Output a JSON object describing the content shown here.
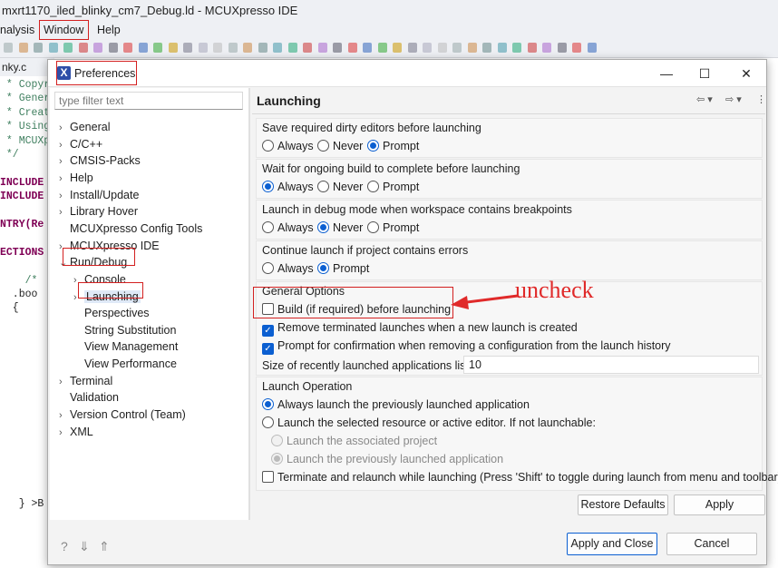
{
  "window_title": "mxrt1170_iled_blinky_cm7_Debug.ld - MCUXpresso IDE",
  "menu": {
    "items": [
      "nalysis",
      "Window",
      "Help"
    ]
  },
  "editor": {
    "tab_label": "nky.c",
    "code_lines": [
      " * Copyr",
      " * Gener",
      " * Creat",
      " * Using",
      " * MCUXp",
      " */",
      "",
      "INCLUDE",
      "INCLUDE",
      "",
      "NTRY(Re",
      "",
      "ECTIONS",
      "",
      "    /*",
      "  .boo",
      "  {",
      "",
      "",
      "",
      "",
      "",
      "",
      "",
      "",
      "",
      "",
      "",
      "",
      "",
      "   } >B"
    ]
  },
  "dialog": {
    "title": "Preferences",
    "filter_placeholder": "type filter text",
    "tree": [
      {
        "label": "General",
        "level": 0,
        "chevron": "right"
      },
      {
        "label": "C/C++",
        "level": 0,
        "chevron": "right"
      },
      {
        "label": "CMSIS-Packs",
        "level": 0,
        "chevron": "right"
      },
      {
        "label": "Help",
        "level": 0,
        "chevron": "right"
      },
      {
        "label": "Install/Update",
        "level": 0,
        "chevron": "right"
      },
      {
        "label": "Library Hover",
        "level": 0,
        "chevron": "right"
      },
      {
        "label": "MCUXpresso Config Tools",
        "level": 0,
        "chevron": "none"
      },
      {
        "label": "MCUXpresso IDE",
        "level": 0,
        "chevron": "right"
      },
      {
        "label": "Run/Debug",
        "level": 0,
        "chevron": "down"
      },
      {
        "label": "Console",
        "level": 1,
        "chevron": "right"
      },
      {
        "label": "Launching",
        "level": 1,
        "chevron": "right",
        "selected": true
      },
      {
        "label": "Perspectives",
        "level": 1,
        "chevron": "none"
      },
      {
        "label": "String Substitution",
        "level": 1,
        "chevron": "none"
      },
      {
        "label": "View Management",
        "level": 1,
        "chevron": "none"
      },
      {
        "label": "View Performance",
        "level": 1,
        "chevron": "none"
      },
      {
        "label": "Terminal",
        "level": 0,
        "chevron": "right"
      },
      {
        "label": "Validation",
        "level": 0,
        "chevron": "none"
      },
      {
        "label": "Version Control (Team)",
        "level": 0,
        "chevron": "right"
      },
      {
        "label": "XML",
        "level": 0,
        "chevron": "right"
      }
    ],
    "page_title": "Launching",
    "groups": {
      "save_dirty": {
        "title": "Save required dirty editors before launching",
        "options": [
          "Always",
          "Never",
          "Prompt"
        ],
        "selected": "Prompt"
      },
      "wait_build": {
        "title": "Wait for ongoing build to complete before launching",
        "options": [
          "Always",
          "Never",
          "Prompt"
        ],
        "selected": "Always"
      },
      "debug_mode": {
        "title": "Launch in debug mode when workspace contains breakpoints",
        "options": [
          "Always",
          "Never",
          "Prompt"
        ],
        "selected": "Never"
      },
      "continue_errors": {
        "title": "Continue launch if project contains errors",
        "options": [
          "Always",
          "Prompt"
        ],
        "selected": "Prompt"
      }
    },
    "general_options": {
      "title": "General Options",
      "build_before_launch": {
        "label": "Build (if required) before launching",
        "checked": false
      },
      "remove_terminated": {
        "label": "Remove terminated launches when a new launch is created",
        "checked": true
      },
      "prompt_confirm": {
        "label": "Prompt for confirmation when removing a configuration from the launch history",
        "checked": true
      },
      "history_size_label": "Size of recently launched applications list:",
      "history_size_value": "10"
    },
    "launch_operation": {
      "title": "Launch Operation",
      "always_previous": {
        "label": "Always launch the previously launched application",
        "selected": true
      },
      "selected_resource": {
        "label": "Launch the selected resource or active editor. If not launchable:",
        "selected": false
      },
      "associated_project": {
        "label": "Launch the associated project",
        "selected": false,
        "disabled": true
      },
      "previously_launched": {
        "label": "Launch the previously launched application",
        "selected": true,
        "disabled": true
      },
      "terminate_relaunch": {
        "label": "Terminate and relaunch while launching (Press 'Shift' to toggle during launch from menu and toolbar)",
        "checked": false
      }
    },
    "buttons": {
      "restore_defaults": "Restore Defaults",
      "apply": "Apply",
      "apply_close": "Apply and Close",
      "cancel": "Cancel"
    }
  },
  "annotation": {
    "text": "uncheck",
    "color": "#e02a2a"
  },
  "colors": {
    "accent": "#0b5fd1",
    "highlight_box": "#d32020"
  }
}
